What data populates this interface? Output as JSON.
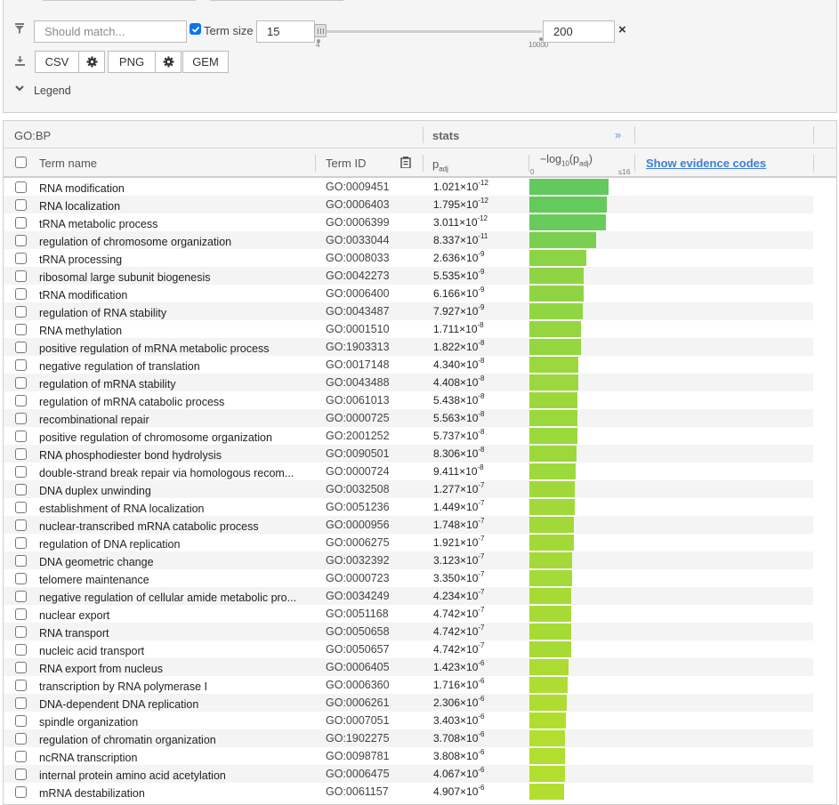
{
  "filters": {
    "match_placeholder": "Should match...",
    "term_size_label": "Term size",
    "term_size_checked": true,
    "size_min": "15",
    "size_max": "200",
    "slider_min_tick": "4",
    "slider_max_tick": "10000",
    "clear_symbol": "×"
  },
  "export": {
    "csv_label": "CSV",
    "png_label": "PNG",
    "gem_label": "GEM"
  },
  "legend": {
    "label": "Legend"
  },
  "table": {
    "source": "GO:BP",
    "stats_label": "stats",
    "collapse_glyph": "»",
    "col_term_name": "Term name",
    "col_term_id": "Term ID",
    "col_padj": "p",
    "col_padj_sub": "adj",
    "col_log_prefix": "−log",
    "col_log_sub": "10",
    "col_log_suffix": "(p",
    "col_log_sub2": "adj",
    "col_log_end": ")",
    "axis_min": "0",
    "axis_max": "≤16",
    "evidence_link": "Show evidence codes"
  },
  "colors": {
    "bar_green": "#62c95e",
    "bar_yellowgreen": "#b6df2c",
    "header_bg": "#f5f5f5",
    "link": "#3d7fd6"
  },
  "rows": [
    {
      "name": "RNA modification",
      "id": "GO:0009451",
      "mant": "1.021",
      "exp": "-12",
      "neglog": 11.99
    },
    {
      "name": "RNA localization",
      "id": "GO:0006403",
      "mant": "1.795",
      "exp": "-12",
      "neglog": 11.75
    },
    {
      "name": "tRNA metabolic process",
      "id": "GO:0006399",
      "mant": "3.011",
      "exp": "-12",
      "neglog": 11.52
    },
    {
      "name": "regulation of chromosome organization",
      "id": "GO:0033044",
      "mant": "8.337",
      "exp": "-11",
      "neglog": 10.08
    },
    {
      "name": "tRNA processing",
      "id": "GO:0008033",
      "mant": "2.636",
      "exp": "-9",
      "neglog": 8.58
    },
    {
      "name": "ribosomal large subunit biogenesis",
      "id": "GO:0042273",
      "mant": "5.535",
      "exp": "-9",
      "neglog": 8.26
    },
    {
      "name": "tRNA modification",
      "id": "GO:0006400",
      "mant": "6.166",
      "exp": "-9",
      "neglog": 8.21
    },
    {
      "name": "regulation of RNA stability",
      "id": "GO:0043487",
      "mant": "7.927",
      "exp": "-9",
      "neglog": 8.1
    },
    {
      "name": "RNA methylation",
      "id": "GO:0001510",
      "mant": "1.711",
      "exp": "-8",
      "neglog": 7.77
    },
    {
      "name": "positive regulation of mRNA metabolic process",
      "id": "GO:1903313",
      "mant": "1.822",
      "exp": "-8",
      "neglog": 7.74
    },
    {
      "name": "negative regulation of translation",
      "id": "GO:0017148",
      "mant": "4.340",
      "exp": "-8",
      "neglog": 7.36
    },
    {
      "name": "regulation of mRNA stability",
      "id": "GO:0043488",
      "mant": "4.408",
      "exp": "-8",
      "neglog": 7.36
    },
    {
      "name": "regulation of mRNA catabolic process",
      "id": "GO:0061013",
      "mant": "5.438",
      "exp": "-8",
      "neglog": 7.26
    },
    {
      "name": "recombinational repair",
      "id": "GO:0000725",
      "mant": "5.563",
      "exp": "-8",
      "neglog": 7.25
    },
    {
      "name": "positive regulation of chromosome organization",
      "id": "GO:2001252",
      "mant": "5.737",
      "exp": "-8",
      "neglog": 7.24
    },
    {
      "name": "RNA phosphodiester bond hydrolysis",
      "id": "GO:0090501",
      "mant": "8.306",
      "exp": "-8",
      "neglog": 7.08
    },
    {
      "name": "double-strand break repair via homologous recom...",
      "id": "GO:0000724",
      "mant": "9.411",
      "exp": "-8",
      "neglog": 7.03
    },
    {
      "name": "DNA duplex unwinding",
      "id": "GO:0032508",
      "mant": "1.277",
      "exp": "-7",
      "neglog": 6.89
    },
    {
      "name": "establishment of RNA localization",
      "id": "GO:0051236",
      "mant": "1.449",
      "exp": "-7",
      "neglog": 6.84
    },
    {
      "name": "nuclear-transcribed mRNA catabolic process",
      "id": "GO:0000956",
      "mant": "1.748",
      "exp": "-7",
      "neglog": 6.76
    },
    {
      "name": "regulation of DNA replication",
      "id": "GO:0006275",
      "mant": "1.921",
      "exp": "-7",
      "neglog": 6.72
    },
    {
      "name": "DNA geometric change",
      "id": "GO:0032392",
      "mant": "3.123",
      "exp": "-7",
      "neglog": 6.51
    },
    {
      "name": "telomere maintenance",
      "id": "GO:0000723",
      "mant": "3.350",
      "exp": "-7",
      "neglog": 6.47
    },
    {
      "name": "negative regulation of cellular amide metabolic pro...",
      "id": "GO:0034249",
      "mant": "4.234",
      "exp": "-7",
      "neglog": 6.37
    },
    {
      "name": "nuclear export",
      "id": "GO:0051168",
      "mant": "4.742",
      "exp": "-7",
      "neglog": 6.32
    },
    {
      "name": "RNA transport",
      "id": "GO:0050658",
      "mant": "4.742",
      "exp": "-7",
      "neglog": 6.32
    },
    {
      "name": "nucleic acid transport",
      "id": "GO:0050657",
      "mant": "4.742",
      "exp": "-7",
      "neglog": 6.32
    },
    {
      "name": "RNA export from nucleus",
      "id": "GO:0006405",
      "mant": "1.423",
      "exp": "-6",
      "neglog": 5.85
    },
    {
      "name": "transcription by RNA polymerase I",
      "id": "GO:0006360",
      "mant": "1.716",
      "exp": "-6",
      "neglog": 5.77
    },
    {
      "name": "DNA-dependent DNA replication",
      "id": "GO:0006261",
      "mant": "2.306",
      "exp": "-6",
      "neglog": 5.64
    },
    {
      "name": "spindle organization",
      "id": "GO:0007051",
      "mant": "3.403",
      "exp": "-6",
      "neglog": 5.47
    },
    {
      "name": "regulation of chromatin organization",
      "id": "GO:1902275",
      "mant": "3.708",
      "exp": "-6",
      "neglog": 5.43
    },
    {
      "name": "ncRNA transcription",
      "id": "GO:0098781",
      "mant": "3.808",
      "exp": "-6",
      "neglog": 5.42
    },
    {
      "name": "internal protein amino acid acetylation",
      "id": "GO:0006475",
      "mant": "4.067",
      "exp": "-6",
      "neglog": 5.39
    },
    {
      "name": "mRNA destabilization",
      "id": "GO:0061157",
      "mant": "4.907",
      "exp": "-6",
      "neglog": 5.31
    }
  ]
}
